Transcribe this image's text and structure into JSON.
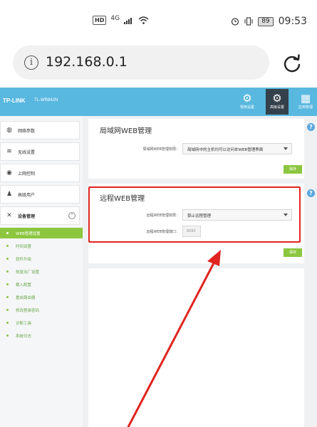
{
  "status_bar": {
    "hd": "HD",
    "network": "4G",
    "battery": "89",
    "time": "09:53"
  },
  "browser": {
    "url": "192.168.0.1",
    "info_icon": "info-icon",
    "reload_icon": "reload-icon"
  },
  "router": {
    "brand": "TP-LINK",
    "model": "TL-WR842N",
    "header_tabs": [
      {
        "label": "常用设置",
        "icon": "gear-icon"
      },
      {
        "label": "高级设置",
        "icon": "gears-icon"
      },
      {
        "label": "应用管理",
        "icon": "grid-icon"
      }
    ],
    "sidebar": {
      "items": [
        {
          "label": "网络参数",
          "icon": "globe-icon"
        },
        {
          "label": "无线设置",
          "icon": "wifi-icon"
        },
        {
          "label": "上网控制",
          "icon": "shield-icon"
        },
        {
          "label": "高级用户",
          "icon": "user-icon"
        },
        {
          "label": "设备管理",
          "icon": "tools-icon",
          "toggle": "⊙"
        }
      ],
      "sub_items": [
        {
          "label": "WEB管理设置",
          "active": true
        },
        {
          "label": "时间设置"
        },
        {
          "label": "软件升级"
        },
        {
          "label": "恢复出厂设置"
        },
        {
          "label": "载入配置"
        },
        {
          "label": "重启路由器"
        },
        {
          "label": "修改登录密码"
        },
        {
          "label": "诊断工具"
        },
        {
          "label": "系统日志"
        }
      ]
    },
    "lan_panel": {
      "title": "局域网WEB管理",
      "field_label": "局域网WEB管理权限：",
      "field_value": "局域网中的主机均可以访问本WEB管理界面",
      "save": "保存"
    },
    "remote_panel": {
      "title": "远程WEB管理",
      "field_label": "远程WEB管理权限：",
      "field_value": "禁止远程管理",
      "port_label": "远程WEB管理端口：",
      "port_value": "8080",
      "save": "保存"
    },
    "help": "?"
  },
  "annotation": {
    "highlight_color": "#e0241f"
  }
}
